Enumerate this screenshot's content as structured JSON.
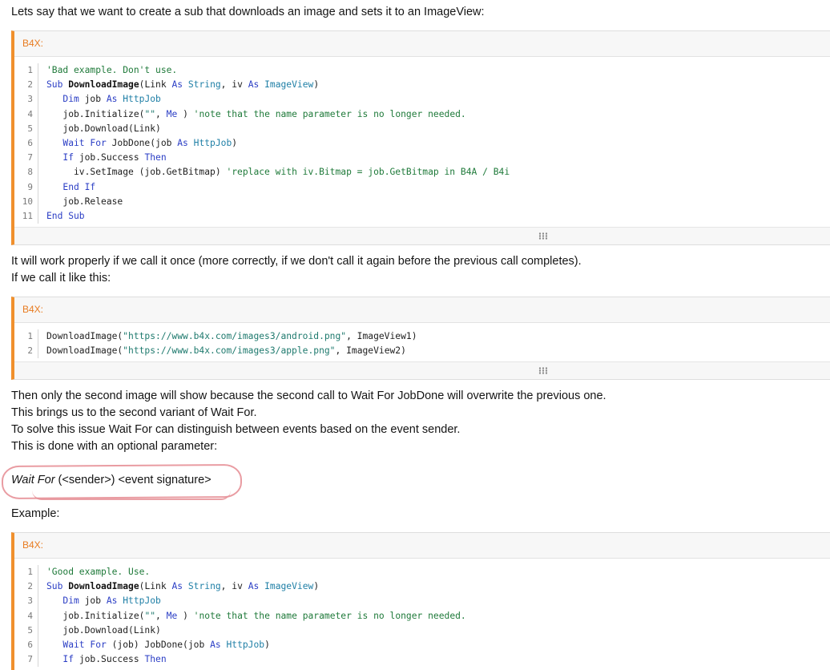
{
  "paragraphs": {
    "intro": "Lets say that we want to create a sub that downloads an image and sets it to an ImageView:",
    "works_once": "It will work properly if we call it once (more correctly, if we don't call it again before the previous call completes).",
    "call_like": "If we call it like this:",
    "only_second": "Then only the second image will show because the second call to Wait For JobDone will overwrite the previous one.",
    "brings_us": "This brings us to the second variant of Wait For.",
    "to_solve": "To solve this issue Wait For can distinguish between events based on the event sender.",
    "optional_param": "This is done with an optional parameter:",
    "syntax_italic": "Wait For",
    "syntax_rest": " (<sender>) <event signature>",
    "example": "Example:"
  },
  "code_blocks": [
    {
      "label": "B4X:",
      "lines": [
        {
          "n": "1",
          "t": [
            [
              "cm",
              "'Bad example. Don't use."
            ]
          ]
        },
        {
          "n": "2",
          "t": [
            [
              "kw",
              "Sub "
            ],
            [
              "fn",
              "DownloadImage"
            ],
            [
              "",
              "(Link "
            ],
            [
              "kw",
              "As "
            ],
            [
              "ty",
              "String"
            ],
            [
              "",
              ", iv "
            ],
            [
              "kw",
              "As "
            ],
            [
              "ty",
              "ImageView"
            ],
            [
              "",
              ")"
            ]
          ]
        },
        {
          "n": "3",
          "t": [
            [
              "",
              "   "
            ],
            [
              "kw",
              "Dim "
            ],
            [
              "",
              "job "
            ],
            [
              "kw",
              "As "
            ],
            [
              "ty",
              "HttpJob"
            ]
          ]
        },
        {
          "n": "4",
          "t": [
            [
              "",
              "   job.Initialize("
            ],
            [
              "st",
              "\"\""
            ],
            [
              "",
              ", "
            ],
            [
              "kw",
              "Me"
            ],
            [
              "",
              " ) "
            ],
            [
              "cm",
              "'note that the name parameter is no longer needed."
            ]
          ]
        },
        {
          "n": "5",
          "t": [
            [
              "",
              "   job.Download(Link)"
            ]
          ]
        },
        {
          "n": "6",
          "t": [
            [
              "",
              "   "
            ],
            [
              "kw",
              "Wait For "
            ],
            [
              "",
              "JobDone(job "
            ],
            [
              "kw",
              "As "
            ],
            [
              "ty",
              "HttpJob"
            ],
            [
              "",
              ")"
            ]
          ]
        },
        {
          "n": "7",
          "t": [
            [
              "",
              "   "
            ],
            [
              "kw",
              "If "
            ],
            [
              "",
              "job.Success "
            ],
            [
              "kw",
              "Then"
            ]
          ]
        },
        {
          "n": "8",
          "t": [
            [
              "",
              "     iv.SetImage (job.GetBitmap) "
            ],
            [
              "cm",
              "'replace with iv.Bitmap = job.GetBitmap in B4A / B4i"
            ]
          ]
        },
        {
          "n": "9",
          "t": [
            [
              "",
              "   "
            ],
            [
              "kw",
              "End If"
            ]
          ]
        },
        {
          "n": "10",
          "t": [
            [
              "",
              "   job.Release"
            ]
          ]
        },
        {
          "n": "11",
          "t": [
            [
              "kw",
              "End Sub"
            ]
          ]
        }
      ]
    },
    {
      "label": "B4X:",
      "lines": [
        {
          "n": "1",
          "t": [
            [
              "",
              "DownloadImage("
            ],
            [
              "st",
              "\"https://www.b4x.com/images3/android.png\""
            ],
            [
              "",
              ", ImageView1)"
            ]
          ]
        },
        {
          "n": "2",
          "t": [
            [
              "",
              "DownloadImage("
            ],
            [
              "st",
              "\"https://www.b4x.com/images3/apple.png\""
            ],
            [
              "",
              ", ImageView2)"
            ]
          ]
        }
      ]
    },
    {
      "label": "B4X:",
      "lines": [
        {
          "n": "1",
          "t": [
            [
              "cm",
              "'Good example. Use."
            ]
          ]
        },
        {
          "n": "2",
          "t": [
            [
              "kw",
              "Sub "
            ],
            [
              "fn",
              "DownloadImage"
            ],
            [
              "",
              "(Link "
            ],
            [
              "kw",
              "As "
            ],
            [
              "ty",
              "String"
            ],
            [
              "",
              ", iv "
            ],
            [
              "kw",
              "As "
            ],
            [
              "ty",
              "ImageView"
            ],
            [
              "",
              ")"
            ]
          ]
        },
        {
          "n": "3",
          "t": [
            [
              "",
              "   "
            ],
            [
              "kw",
              "Dim "
            ],
            [
              "",
              "job "
            ],
            [
              "kw",
              "As "
            ],
            [
              "ty",
              "HttpJob"
            ]
          ]
        },
        {
          "n": "4",
          "t": [
            [
              "",
              "   job.Initialize("
            ],
            [
              "st",
              "\"\""
            ],
            [
              "",
              ", "
            ],
            [
              "kw",
              "Me"
            ],
            [
              "",
              " ) "
            ],
            [
              "cm",
              "'note that the name parameter is no longer needed."
            ]
          ]
        },
        {
          "n": "5",
          "t": [
            [
              "",
              "   job.Download(Link)"
            ]
          ]
        },
        {
          "n": "6",
          "t": [
            [
              "",
              "   "
            ],
            [
              "kw",
              "Wait For "
            ],
            [
              "",
              "(job) JobDone(job "
            ],
            [
              "kw",
              "As "
            ],
            [
              "ty",
              "HttpJob"
            ],
            [
              "",
              ")"
            ]
          ]
        },
        {
          "n": "7",
          "t": [
            [
              "",
              "   "
            ],
            [
              "kw",
              "If "
            ],
            [
              "",
              "job.Success "
            ],
            [
              "kw",
              "Then"
            ]
          ]
        }
      ]
    }
  ]
}
